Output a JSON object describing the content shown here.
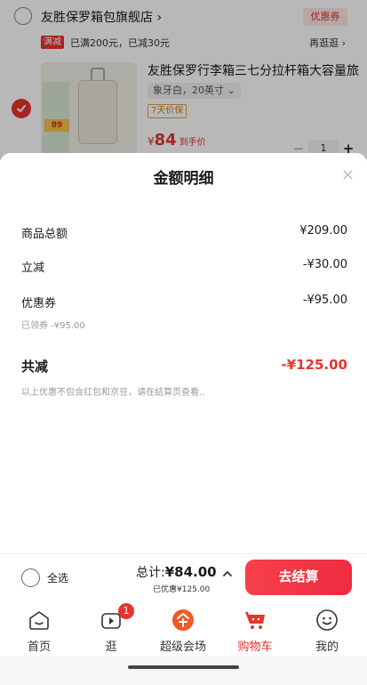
{
  "cart": {
    "shop_name": "友胜保罗箱包旗舰店 ›",
    "coupon_label": "优惠券",
    "promo_badge": "满减",
    "promo_text": "已满200元，已减30元",
    "promo_link": "再逛逛 ›",
    "product": {
      "title": "友胜保罗行李箱三七分拉杆箱大容量旅",
      "spec": "象牙白，20英寸 ⌄",
      "return_tag": "7天价保",
      "price_currency": "¥",
      "price": "84",
      "price_note": "到手价",
      "thumb_price": "89",
      "quantity": "1",
      "minus": "−",
      "plus": "+"
    }
  },
  "sheet": {
    "title": "金额明细",
    "close": "×",
    "rows": [
      {
        "label": "商品总额",
        "value": "¥209.00"
      },
      {
        "label": "立减",
        "value": "-¥30.00"
      },
      {
        "label": "优惠券",
        "value": "-¥95.00"
      }
    ],
    "coupon_note": "已领券 -¥95.00",
    "total_label": "共减",
    "total_value": "-¥125.00",
    "footnote": "以上优惠不包含红包和京豆，请在结算页查看.."
  },
  "checkout": {
    "select_all": "全选",
    "total_prefix": "总计:",
    "total_amount": "¥84.00",
    "discount": "已优惠¥125.00",
    "button": "去结算"
  },
  "tabbar": {
    "items": [
      {
        "label": "首页",
        "icon": "home-icon"
      },
      {
        "label": "逛",
        "icon": "video-icon",
        "badge": "1"
      },
      {
        "label": "超级会场",
        "icon": "super-venue-icon"
      },
      {
        "label": "购物车",
        "icon": "cart-icon"
      },
      {
        "label": "我的",
        "icon": "profile-icon"
      }
    ]
  },
  "colors": {
    "accent": "#e8342c",
    "overlay": "rgba(0,0,0,0.28)"
  }
}
